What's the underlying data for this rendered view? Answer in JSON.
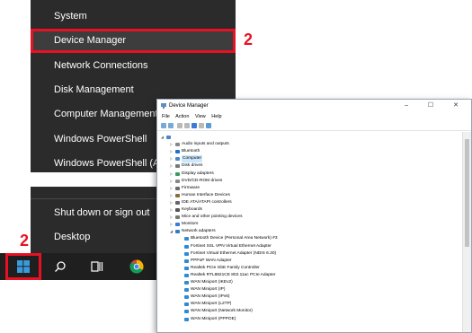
{
  "winx_menu": {
    "items": [
      "System",
      "Device Manager",
      "Network Connections",
      "Disk Management",
      "Computer Management",
      "Windows PowerShell",
      "Windows PowerShell (Ad"
    ]
  },
  "winx_menu_bottom": {
    "items": [
      "Shut down or sign out",
      "Desktop"
    ]
  },
  "callouts": {
    "device_manager": "2",
    "start_button": "2"
  },
  "accent_color": "#e81123",
  "device_manager": {
    "title": "Device Manager",
    "window_controls": "–  ☐  ✕",
    "menu": [
      "File",
      "Action",
      "View",
      "Help"
    ],
    "tree": [
      {
        "label": "",
        "icon": "computer-icon",
        "expanded": true,
        "level": 0
      },
      {
        "label": "Audio inputs and outputs",
        "icon": "speaker-icon",
        "level": 1
      },
      {
        "label": "Bluetooth",
        "icon": "bluetooth-icon",
        "level": 1
      },
      {
        "label": "Computer",
        "icon": "computer-icon",
        "level": 1,
        "selected": true
      },
      {
        "label": "Disk drives",
        "icon": "disk-icon",
        "level": 1
      },
      {
        "label": "Display adapters",
        "icon": "display-icon",
        "level": 1
      },
      {
        "label": "DVD/CD-ROM drives",
        "icon": "dvd-icon",
        "level": 1
      },
      {
        "label": "Firmware",
        "icon": "chip-icon",
        "level": 1
      },
      {
        "label": "Human Interface Devices",
        "icon": "hid-icon",
        "level": 1
      },
      {
        "label": "IDE ATA/ATAPI controllers",
        "icon": "controller-icon",
        "level": 1
      },
      {
        "label": "Keyboards",
        "icon": "keyboard-icon",
        "level": 1
      },
      {
        "label": "Mice and other pointing devices",
        "icon": "mouse-icon",
        "level": 1
      },
      {
        "label": "Monitors",
        "icon": "monitor-icon",
        "level": 1
      },
      {
        "label": "Network adapters",
        "icon": "network-icon",
        "level": 1,
        "expanded": true
      },
      {
        "label": "Bluetooth Device (Personal Area Network) #3",
        "icon": "network-card-icon",
        "level": 2
      },
      {
        "label": "Fortinet SSL VPN Virtual Ethernet Adapter",
        "icon": "network-card-icon",
        "level": 2
      },
      {
        "label": "Fortinet Virtual Ethernet Adapter (NDIS 6.30)",
        "icon": "network-card-icon",
        "level": 2
      },
      {
        "label": "PPPoP WAN Adapter",
        "icon": "network-card-icon",
        "level": 2
      },
      {
        "label": "Realtek PCIe GbE Family Controller",
        "icon": "network-card-icon",
        "level": 2
      },
      {
        "label": "Realtek RTL8821CE 802.11ac PCIe Adapter",
        "icon": "network-card-icon",
        "level": 2
      },
      {
        "label": "WAN Miniport (IKEv2)",
        "icon": "network-card-icon",
        "level": 2
      },
      {
        "label": "WAN Miniport (IP)",
        "icon": "network-card-icon",
        "level": 2
      },
      {
        "label": "WAN Miniport (IPv6)",
        "icon": "network-card-icon",
        "level": 2
      },
      {
        "label": "WAN Miniport (L2TP)",
        "icon": "network-card-icon",
        "level": 2
      },
      {
        "label": "WAN Miniport (Network Monitor)",
        "icon": "network-card-icon",
        "level": 2
      },
      {
        "label": "WAN Miniport (PPPOE)",
        "icon": "network-card-icon",
        "level": 2
      }
    ]
  }
}
